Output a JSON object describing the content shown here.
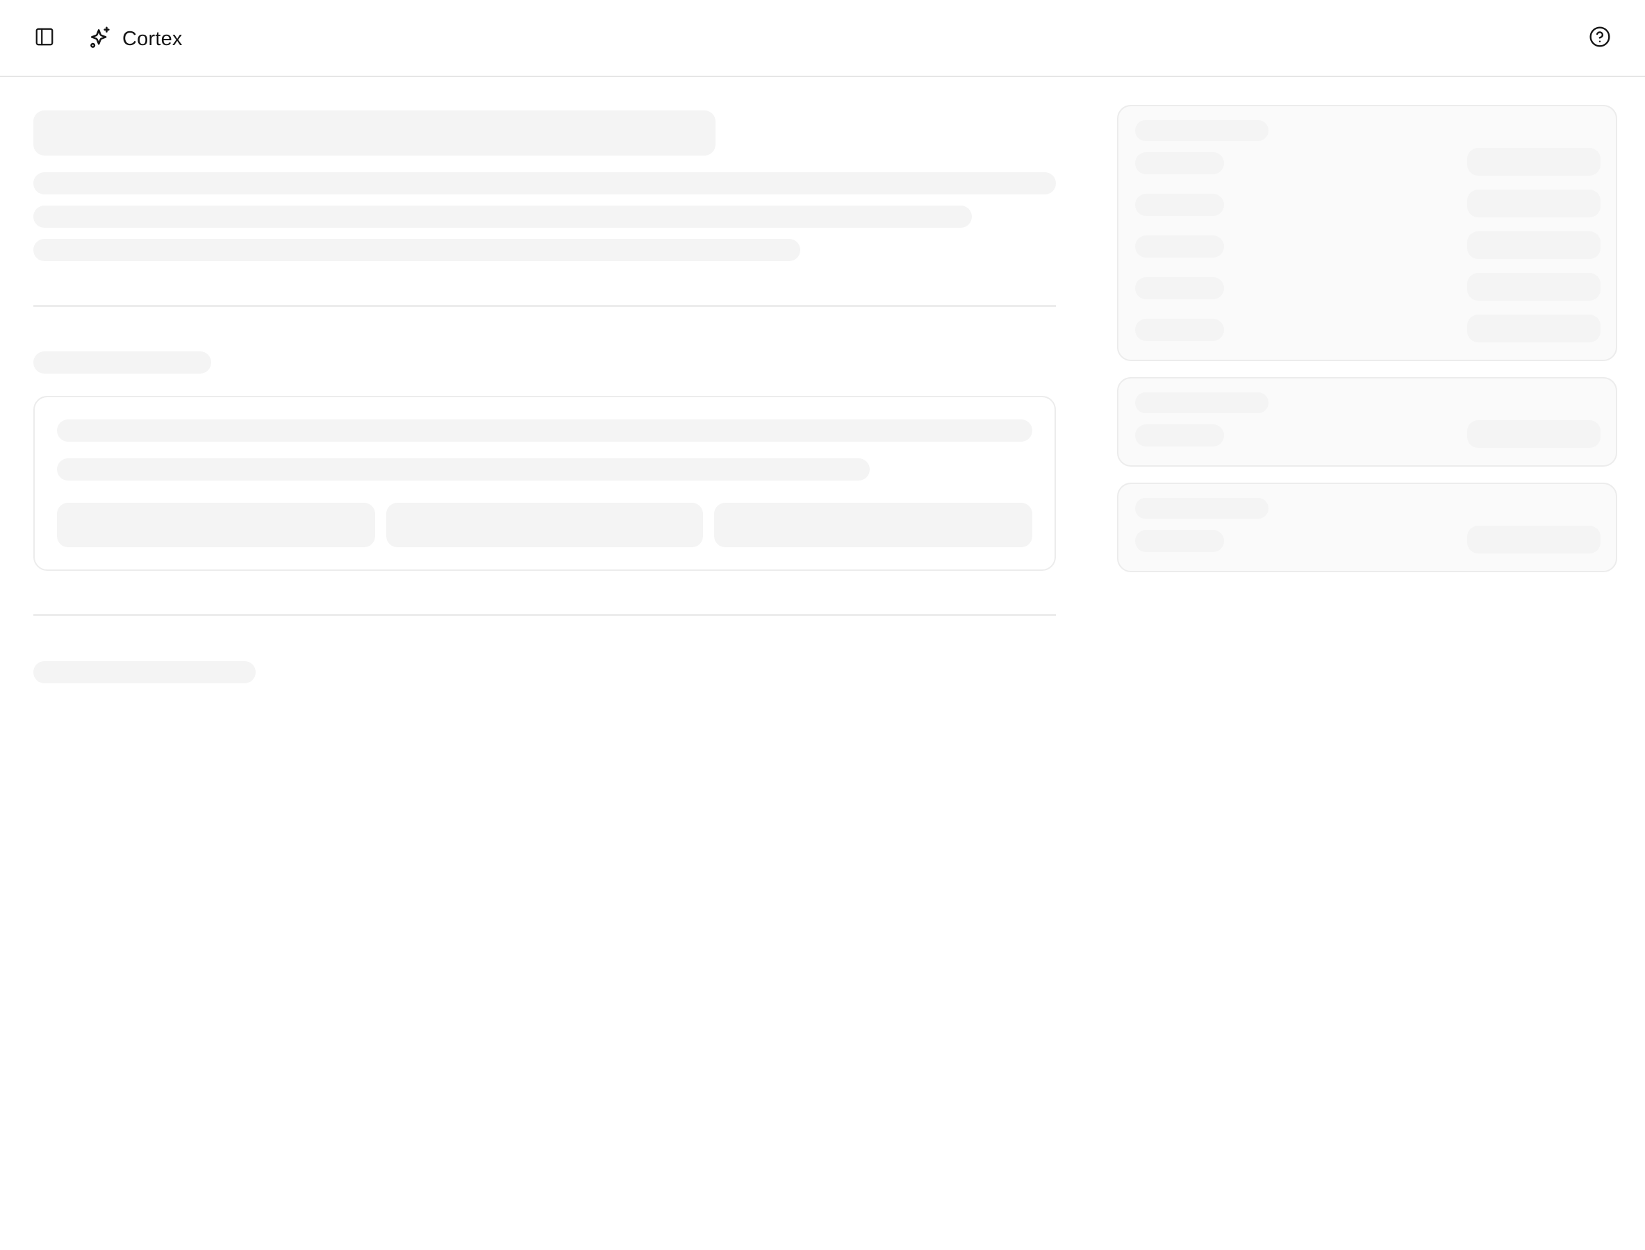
{
  "header": {
    "brand_name": "Cortex",
    "sidebar_toggle_icon": "sidebar-panel-icon",
    "brand_icon": "sparkles-icon",
    "help_icon": "help-circle-icon"
  },
  "colors": {
    "skeleton": "#f4f4f4",
    "border": "#ececec",
    "side_card_bg": "#fafafa",
    "text": "#141414"
  }
}
